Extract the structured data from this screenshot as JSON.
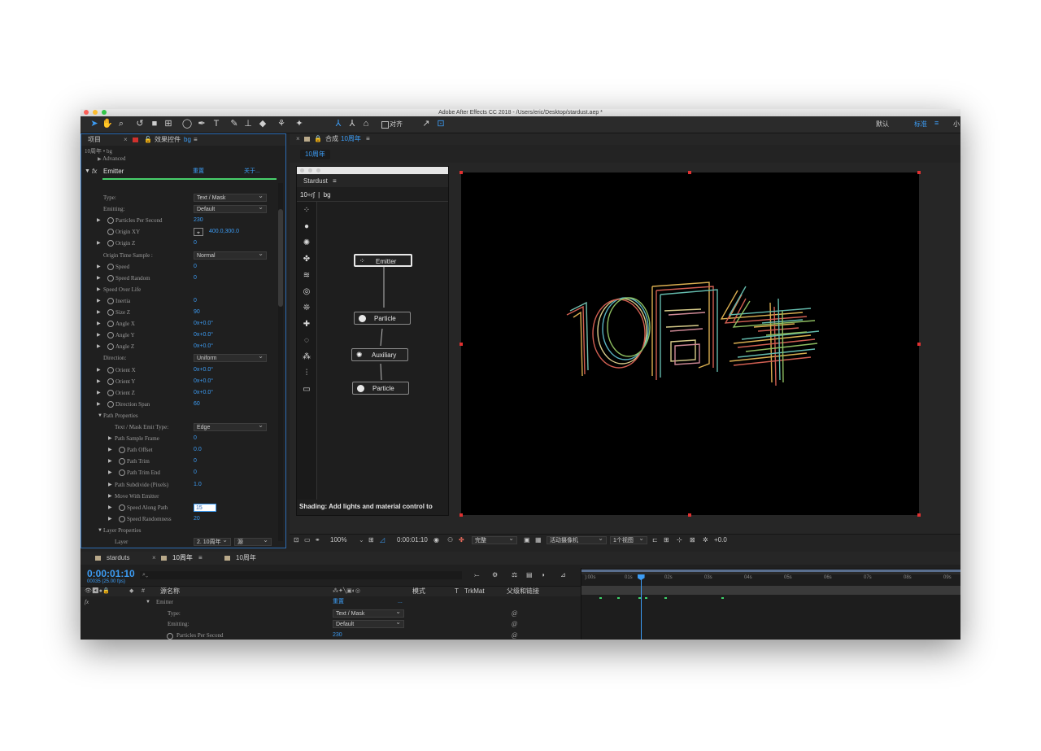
{
  "window": {
    "title": "Adobe After Effects CC 2018 - /Users/eric/Desktop/stardust.aep *"
  },
  "toolbar": {
    "align_label": "对齐",
    "workspace_default": "默认",
    "workspace_standard": "标准",
    "workspace_small": "小"
  },
  "left_panel": {
    "tab_project": "项目",
    "tab_effects": "效果控件",
    "tab_effects_layer": "bg",
    "path": "10周年 • bg",
    "advanced": "Advanced",
    "effect_name": "Emitter",
    "reset": "重置",
    "about": "关于...",
    "scroll_pos": 0.1
  },
  "emitter_props": [
    {
      "name": "Type:",
      "select": "Text / Mask"
    },
    {
      "name": "Emitting:",
      "select": "Default"
    },
    {
      "name": "Particles Per Second",
      "value": "230",
      "tri": true,
      "sw": true
    },
    {
      "name": "Origin XY",
      "value": "400.0,300.0",
      "sw": true,
      "target": true
    },
    {
      "name": "Origin Z",
      "value": "0",
      "tri": true,
      "sw": true
    },
    {
      "name": "Origin Time Sample :",
      "select": "Normal"
    },
    {
      "name": "Speed",
      "value": "0",
      "tri": true,
      "sw": true
    },
    {
      "name": "Speed Random",
      "value": "0",
      "tri": true,
      "sw": true
    },
    {
      "name": "Speed Over Life",
      "tri": true
    },
    {
      "name": "Inertia",
      "value": "0",
      "tri": true,
      "sw": true
    },
    {
      "name": "Size Z",
      "value": "90",
      "tri": true,
      "sw": true
    },
    {
      "name": "Angle X",
      "value": "0x+0.0°",
      "tri": true,
      "sw": true
    },
    {
      "name": "Angle Y",
      "value": "0x+0.0°",
      "tri": true,
      "sw": true
    },
    {
      "name": "Angle Z",
      "value": "0x+0.0°",
      "tri": true,
      "sw": true
    },
    {
      "name": "Direction:",
      "select": "Uniform"
    },
    {
      "name": "Orient X",
      "value": "0x+0.0°",
      "tri": true,
      "sw": true
    },
    {
      "name": "Orient Y",
      "value": "0x+0.0°",
      "tri": true,
      "sw": true
    },
    {
      "name": "Orient Z",
      "value": "0x+0.0°",
      "tri": true,
      "sw": true
    },
    {
      "name": "Direction Span",
      "value": "60",
      "tri": true,
      "sw": true
    },
    {
      "name": "Path Properties",
      "tri": true,
      "open": true
    },
    {
      "name": "Text / Mask Emit Type:",
      "select": "Edge",
      "sub": true
    },
    {
      "name": "Path Sample Frame",
      "value": "0",
      "tri": true,
      "sub": true
    },
    {
      "name": "Path Offset",
      "value": "0.0",
      "tri": true,
      "sw": true,
      "sub": true
    },
    {
      "name": "Path Trim",
      "value": "0",
      "tri": true,
      "sw": true,
      "sub": true
    },
    {
      "name": "Path Trim End",
      "value": "0",
      "tri": true,
      "sw": true,
      "sub": true
    },
    {
      "name": "Path Subdivide (Pixels)",
      "value": "1.0",
      "tri": true,
      "sub": true
    },
    {
      "name": "Move With Emitter",
      "tri": true,
      "sub": true
    },
    {
      "name": "Speed Along Path",
      "value": "15",
      "tri": true,
      "sw": true,
      "sub": true,
      "input": true
    },
    {
      "name": "Speed Randomness",
      "value": "20",
      "tri": true,
      "sw": true,
      "sub": true
    },
    {
      "name": "Layer Properties",
      "tri": true,
      "open": true
    },
    {
      "name": "Layer",
      "select": "2. 10周年",
      "select2": "源",
      "sub": true
    }
  ],
  "comp_panel": {
    "tab_label": "合成",
    "comp_name": "10周年",
    "crumb": "10周年",
    "zoom": "100%",
    "timecode": "0:00:01:10",
    "resolution": "完整",
    "camera": "活动摄像机",
    "views": "1个视图",
    "exposure": "+0.0"
  },
  "stardust": {
    "title": "Stardust",
    "breadcrumb": "10÷ɾʃ  |  bg",
    "footer": "Shading: Add lights and material control to",
    "nodes": [
      "Emitter",
      "Particle",
      "Auxiliary",
      "Particle"
    ]
  },
  "timeline": {
    "tabs": [
      "starduts",
      "10周年",
      "10周年"
    ],
    "timecode": "0:00:01:10",
    "frame_info": "00035 (25.00 fps)",
    "search_placeholder": "⌕⌄",
    "col_source": "源名称",
    "col_mode": "模式",
    "col_t": "T",
    "col_trkmat": "TrkMat",
    "col_parent": "父级和链接",
    "rows": [
      {
        "name": "Emitter",
        "value": "重置",
        "extra": "..."
      },
      {
        "name": "Type:",
        "select": "Text / Mask"
      },
      {
        "name": "Emitting:",
        "select": "Default"
      },
      {
        "name": "Particles Per Second",
        "value": "230"
      }
    ],
    "ruler": [
      "):00s",
      "01s",
      "02s",
      "03s",
      "04s",
      "05s",
      "06s",
      "07s",
      "08s",
      "09s"
    ],
    "playhead_seconds": 1.4
  },
  "colors": {
    "accent": "#3c9cf4",
    "bg": "#232323",
    "panel": "#1f1f1f"
  }
}
